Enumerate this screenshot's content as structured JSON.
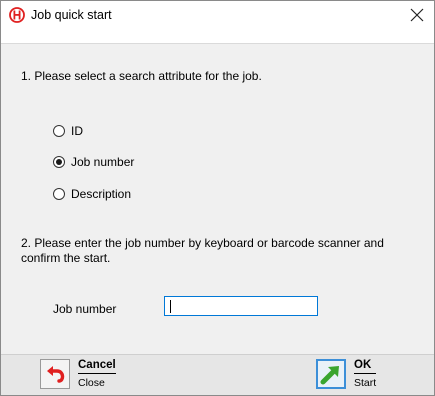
{
  "window": {
    "title": "Job quick start",
    "close_glyph": "✕"
  },
  "step1": {
    "text": "1. Please select a search attribute for the job.",
    "options": [
      {
        "label": "ID",
        "selected": false
      },
      {
        "label": "Job number",
        "selected": true
      },
      {
        "label": "Description",
        "selected": false
      }
    ]
  },
  "step2": {
    "text": "2. Please enter the job number by keyboard or barcode scanner and confirm the start.",
    "field_label": "Job number",
    "field_value": ""
  },
  "buttons": {
    "cancel": {
      "label": "Cancel",
      "sub": "Close",
      "icon": "undo-arrow-icon"
    },
    "ok": {
      "label": "OK",
      "sub": "Start",
      "icon": "green-arrow-icon"
    }
  },
  "colors": {
    "accent": "#0078d7",
    "brand_red": "#e02020",
    "ok_green": "#3aa52f"
  }
}
